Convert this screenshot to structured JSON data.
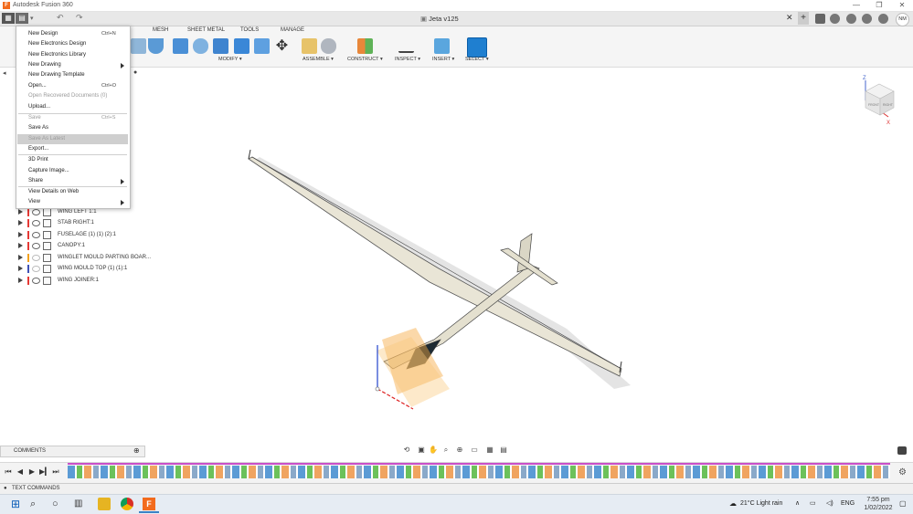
{
  "window": {
    "title": "Autodesk Fusion 360",
    "logo_letter": "F",
    "minimize": "—",
    "maximize": "❐",
    "close": "✕"
  },
  "document": {
    "tab_title": "Jeta v125",
    "close_tab": "✕",
    "new_tab": "+",
    "user_initials": "NM"
  },
  "toolbar": {
    "tabs": [
      "MESH",
      "SHEET METAL",
      "TOOLS",
      "MANAGE"
    ],
    "groups": [
      "MODIFY ▾",
      "ASSEMBLE ▾",
      "CONSTRUCT ▾",
      "INSPECT ▾",
      "INSERT ▾",
      "SELECT ▾"
    ]
  },
  "file_menu": {
    "items": [
      {
        "label": "New Design",
        "shortcut": "Ctrl+N"
      },
      {
        "label": "New Electronics Design",
        "shortcut": ""
      },
      {
        "label": "New Electronics Library",
        "shortcut": ""
      },
      {
        "label": "New Drawing",
        "shortcut": ""
      },
      {
        "label": "New Drawing Template",
        "shortcut": ""
      },
      {
        "label": "Open...",
        "shortcut": "Ctrl+O"
      },
      {
        "label": "Open Recovered Documents (0)",
        "shortcut": ""
      },
      {
        "label": "Upload...",
        "shortcut": ""
      },
      {
        "label": "Save",
        "shortcut": "Ctrl+S"
      },
      {
        "label": "Save As",
        "shortcut": ""
      },
      {
        "label": "Save As Latest",
        "shortcut": ""
      },
      {
        "label": "Export...",
        "shortcut": ""
      },
      {
        "label": "3D Print",
        "shortcut": ""
      },
      {
        "label": "Capture Image...",
        "shortcut": ""
      },
      {
        "label": "Share",
        "shortcut": ""
      },
      {
        "label": "View Details on Web",
        "shortcut": ""
      },
      {
        "label": "View",
        "shortcut": ""
      }
    ]
  },
  "browser": {
    "components": [
      {
        "label": "WING LEFT 1:1",
        "color": "#e53935"
      },
      {
        "label": "STAB RIGHT:1",
        "color": "#e53935"
      },
      {
        "label": "FUSELAGE (1) (1) (2):1",
        "color": "#e53935"
      },
      {
        "label": "CANOPY:1",
        "color": "#e53935"
      },
      {
        "label": "WINGLET MOULD PARTING BOAR...",
        "color": "#f4a21d"
      },
      {
        "label": "WING MOULD TOP (1) (1):1",
        "color": "#3f51b5"
      },
      {
        "label": "WING JOINER:1",
        "color": "#e53935"
      }
    ]
  },
  "viewcube": {
    "z": "Z",
    "x": "X",
    "front": "FRONT",
    "right": "RIGHT"
  },
  "bottom": {
    "comments": "COMMENTS",
    "text_commands": "TEXT COMMANDS"
  },
  "taskbar": {
    "weather": "21°C  Light rain",
    "language": "ENG",
    "time": "7:55 pm",
    "date": "1/02/2022"
  },
  "colors": {
    "accent_blue": "#0696d7",
    "fusion_orange": "#f26b1d",
    "menu_highlight": "#cfcfcf"
  }
}
